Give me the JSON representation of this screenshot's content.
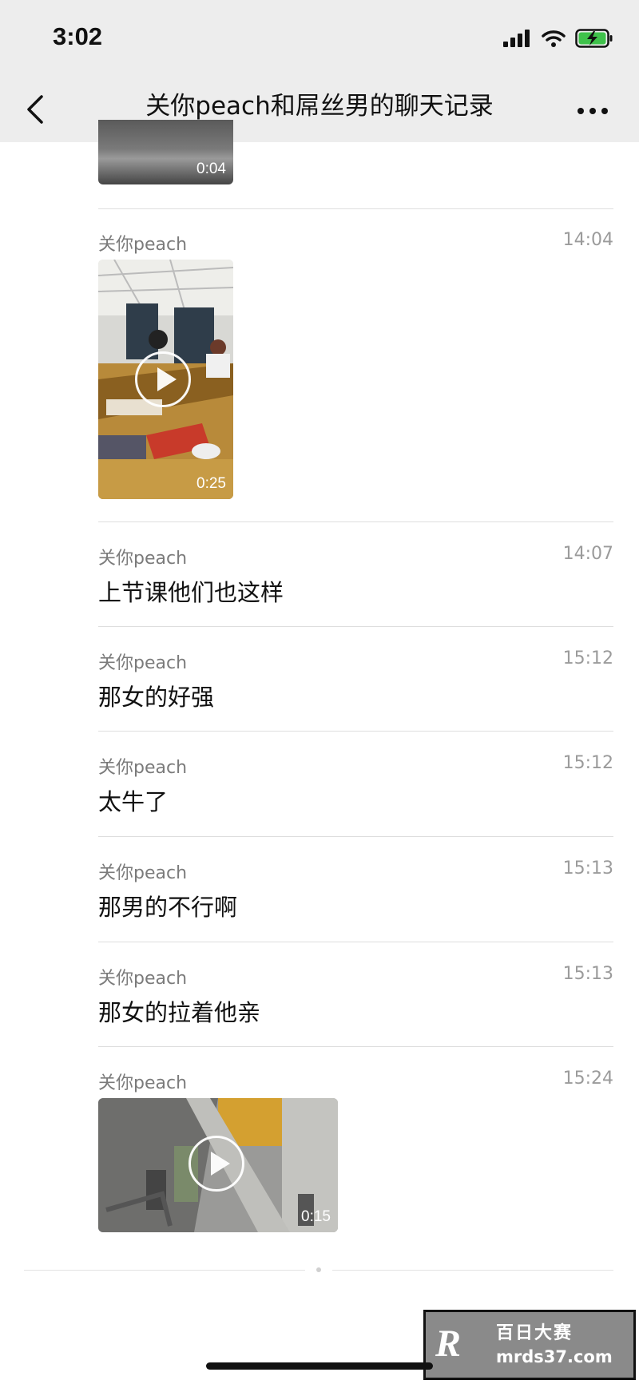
{
  "status": {
    "time": "3:02"
  },
  "nav": {
    "title": "关你peach和屌丝男的聊天记录"
  },
  "messages": [
    {
      "type": "video",
      "duration": "0:04"
    },
    {
      "type": "video",
      "sender": "关你peach",
      "time": "14:04",
      "duration": "0:25"
    },
    {
      "type": "text",
      "sender": "关你peach",
      "time": "14:07",
      "text": "上节课他们也这样"
    },
    {
      "type": "text",
      "sender": "关你peach",
      "time": "15:12",
      "text": "那女的好强"
    },
    {
      "type": "text",
      "sender": "关你peach",
      "time": "15:12",
      "text": "太牛了"
    },
    {
      "type": "text",
      "sender": "关你peach",
      "time": "15:13",
      "text": "那男的不行啊"
    },
    {
      "type": "text",
      "sender": "关你peach",
      "time": "15:13",
      "text": "那女的拉着他亲"
    },
    {
      "type": "video",
      "sender": "关你peach",
      "time": "15:24",
      "duration": "0:15"
    }
  ],
  "watermark": {
    "logo": "R",
    "title": "百日大赛",
    "url": "mrds37.com"
  },
  "colors": {
    "nav_bg": "#ededed",
    "divider": "#dedede",
    "battery_green": "#3fc24b"
  }
}
